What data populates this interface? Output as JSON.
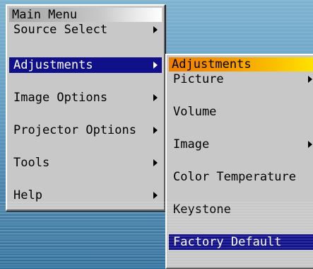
{
  "main_menu": {
    "title": "Main Menu",
    "items": [
      {
        "label": "Source Select",
        "has_submenu": true,
        "selected": false
      },
      {
        "label": "Adjustments",
        "has_submenu": true,
        "selected": true
      },
      {
        "label": "Image Options",
        "has_submenu": true,
        "selected": false
      },
      {
        "label": "Projector Options",
        "has_submenu": true,
        "selected": false
      },
      {
        "label": "Tools",
        "has_submenu": true,
        "selected": false
      },
      {
        "label": "Help",
        "has_submenu": true,
        "selected": false
      }
    ]
  },
  "sub_menu": {
    "title": "Adjustments",
    "items": [
      {
        "label": "Picture",
        "has_submenu": true,
        "selected": false
      },
      {
        "label": "Volume",
        "has_submenu": false,
        "selected": false
      },
      {
        "label": "Image",
        "has_submenu": true,
        "selected": false
      },
      {
        "label": "Color Temperature",
        "has_submenu": false,
        "selected": false
      },
      {
        "label": "Keystone",
        "has_submenu": false,
        "selected": false
      },
      {
        "label": "Factory Default",
        "has_submenu": false,
        "selected": true
      }
    ]
  },
  "colors": {
    "selection": "#10108a",
    "menu_bg": "#c8c8c8",
    "submenu_title_start": "#f07d00",
    "submenu_title_end": "#ffe400"
  }
}
